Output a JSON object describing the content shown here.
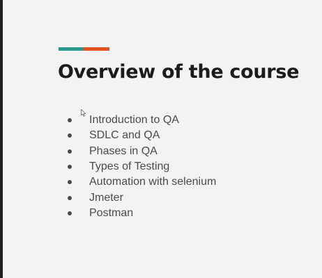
{
  "slide": {
    "title": "Overview of the course",
    "accent_colors": {
      "teal": "#2a9a8c",
      "orange": "#e0541b"
    },
    "bullets": [
      "Introduction to QA",
      "SDLC and QA",
      "Phases in QA",
      "Types of Testing",
      "Automation with selenium",
      "Jmeter",
      "Postman"
    ]
  },
  "cursor": {
    "icon": "mouse-pointer-icon"
  }
}
